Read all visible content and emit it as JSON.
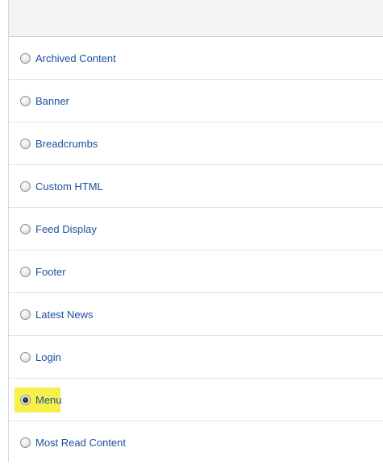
{
  "modules": {
    "items": [
      {
        "label": "Archived Content",
        "selected": false
      },
      {
        "label": "Banner",
        "selected": false
      },
      {
        "label": "Breadcrumbs",
        "selected": false
      },
      {
        "label": "Custom HTML",
        "selected": false
      },
      {
        "label": "Feed Display",
        "selected": false
      },
      {
        "label": "Footer",
        "selected": false
      },
      {
        "label": "Latest News",
        "selected": false
      },
      {
        "label": "Login",
        "selected": false
      },
      {
        "label": "Menu",
        "selected": true
      },
      {
        "label": "Most Read Content",
        "selected": false
      }
    ]
  },
  "colors": {
    "link": "#1a4f9c",
    "highlight": "#f5f04a",
    "header_bg": "#f3f3f3"
  }
}
